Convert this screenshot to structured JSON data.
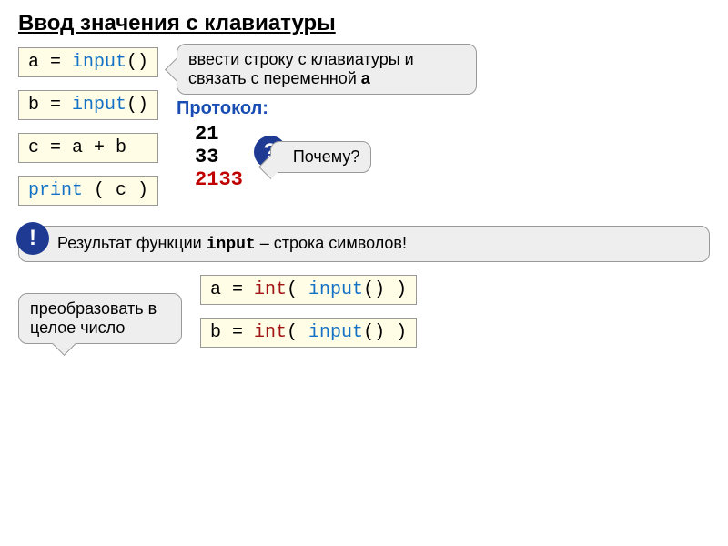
{
  "title": "Ввод значения с клавиатуры",
  "code": {
    "line1_a": "a = ",
    "line1_fn": "input",
    "line1_p": "()",
    "line2_a": "b = ",
    "line2_fn": "input",
    "line2_p": "()",
    "line3": "c = a + b",
    "line4_fn": "print",
    "line4_p": " ( c )"
  },
  "callout1": {
    "text1": "ввести строку с клавиатуры и связать с переменной ",
    "var": "a"
  },
  "protocol": {
    "label": "Протокол:",
    "v1": "21",
    "v2": "33",
    "v3": "2133"
  },
  "why": {
    "badge": "?",
    "text": "Почему?"
  },
  "result": {
    "badge": "!",
    "pre": "Результат функции ",
    "kw": "input",
    "post": " – строка символов!"
  },
  "convert": {
    "text": "преобразовать в целое число"
  },
  "intcode": {
    "l1_a": "a = ",
    "l1_int": "int",
    "l1_p1": "( ",
    "l1_fn": "input",
    "l1_p2": "() )",
    "l2_a": "b = ",
    "l2_int": "int",
    "l2_p1": "( ",
    "l2_fn": "input",
    "l2_p2": "() )"
  }
}
